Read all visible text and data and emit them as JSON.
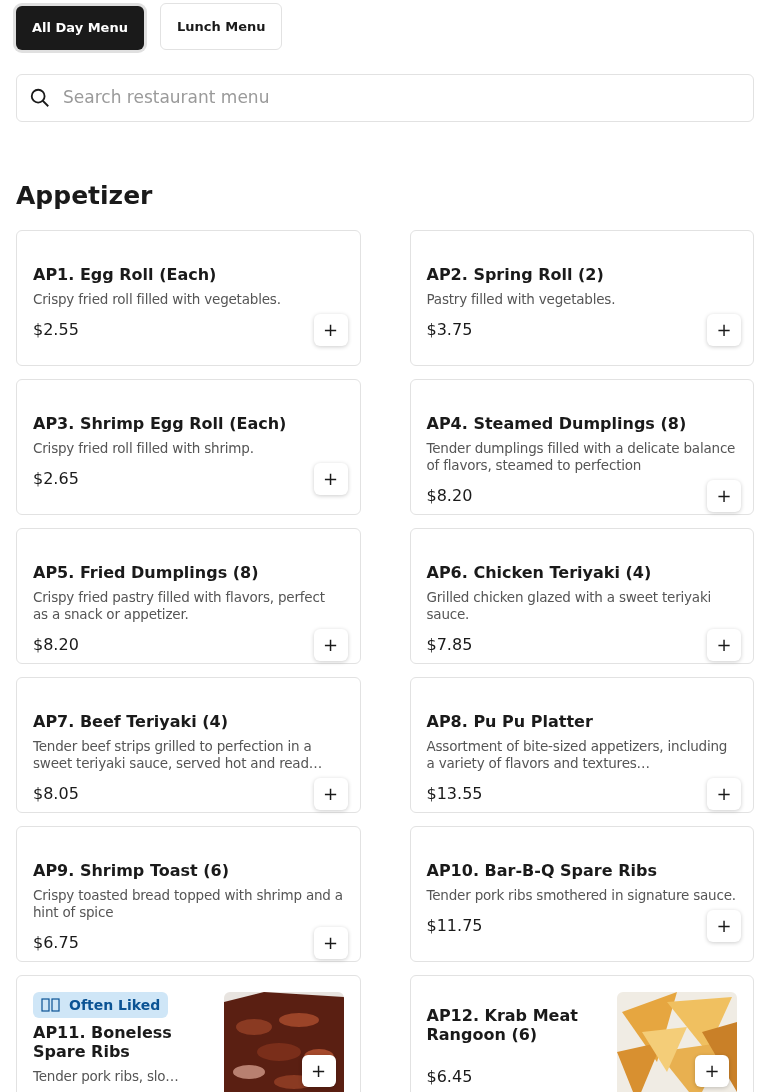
{
  "menu_tabs": [
    {
      "label": "All Day Menu",
      "selected": true
    },
    {
      "label": "Lunch Menu",
      "selected": false
    }
  ],
  "search": {
    "placeholder": "Search restaurant menu"
  },
  "section": {
    "title": "Appetizer"
  },
  "items": [
    {
      "name": "AP1. Egg Roll (Each)",
      "description": "Crispy fried roll filled with vegetables.",
      "price": "$2.55",
      "add": "+"
    },
    {
      "name": "AP2. Spring Roll (2)",
      "description": "Pastry filled with vegetables.",
      "price": "$3.75",
      "add": "+"
    },
    {
      "name": "AP3. Shrimp Egg Roll (Each)",
      "description": "Crispy fried roll filled with shrimp.",
      "price": "$2.65",
      "add": "+"
    },
    {
      "name": "AP4. Steamed Dumplings (8)",
      "description": "Tender dumplings filled with a delicate balance of flavors, steamed to perfection",
      "price": "$8.20",
      "add": "+"
    },
    {
      "name": "AP5. Fried Dumplings (8)",
      "description": "Crispy fried pastry filled with flavors, perfect as a snack or appetizer.",
      "price": "$8.20",
      "add": "+"
    },
    {
      "name": "AP6. Chicken Teriyaki (4)",
      "description": "Grilled chicken glazed with a sweet teriyaki sauce.",
      "price": "$7.85",
      "add": "+"
    },
    {
      "name": "AP7. Beef Teriyaki (4)",
      "description": "Tender beef strips grilled to perfection in a sweet teriyaki sauce, served hot and read…",
      "price": "$8.05",
      "add": "+"
    },
    {
      "name": "AP8. Pu Pu Platter",
      "description": "Assortment of bite-sized appetizers, including a variety of flavors and textures…",
      "price": "$13.55",
      "add": "+"
    },
    {
      "name": "AP9. Shrimp Toast (6)",
      "description": "Crispy toasted bread topped with shrimp and a hint of spice",
      "price": "$6.75",
      "add": "+"
    },
    {
      "name": "AP10. Bar-B-Q Spare Ribs",
      "description": "Tender pork ribs smothered in signature sauce.",
      "price": "$11.75",
      "add": "+"
    },
    {
      "name": "AP11. Boneless Spare Ribs",
      "badge": "Often Liked",
      "description": "Tender pork ribs, slo…",
      "add": "+"
    },
    {
      "name": "AP12. Krab Meat Rangoon (6)",
      "price": "$6.45",
      "add": "+"
    }
  ]
}
